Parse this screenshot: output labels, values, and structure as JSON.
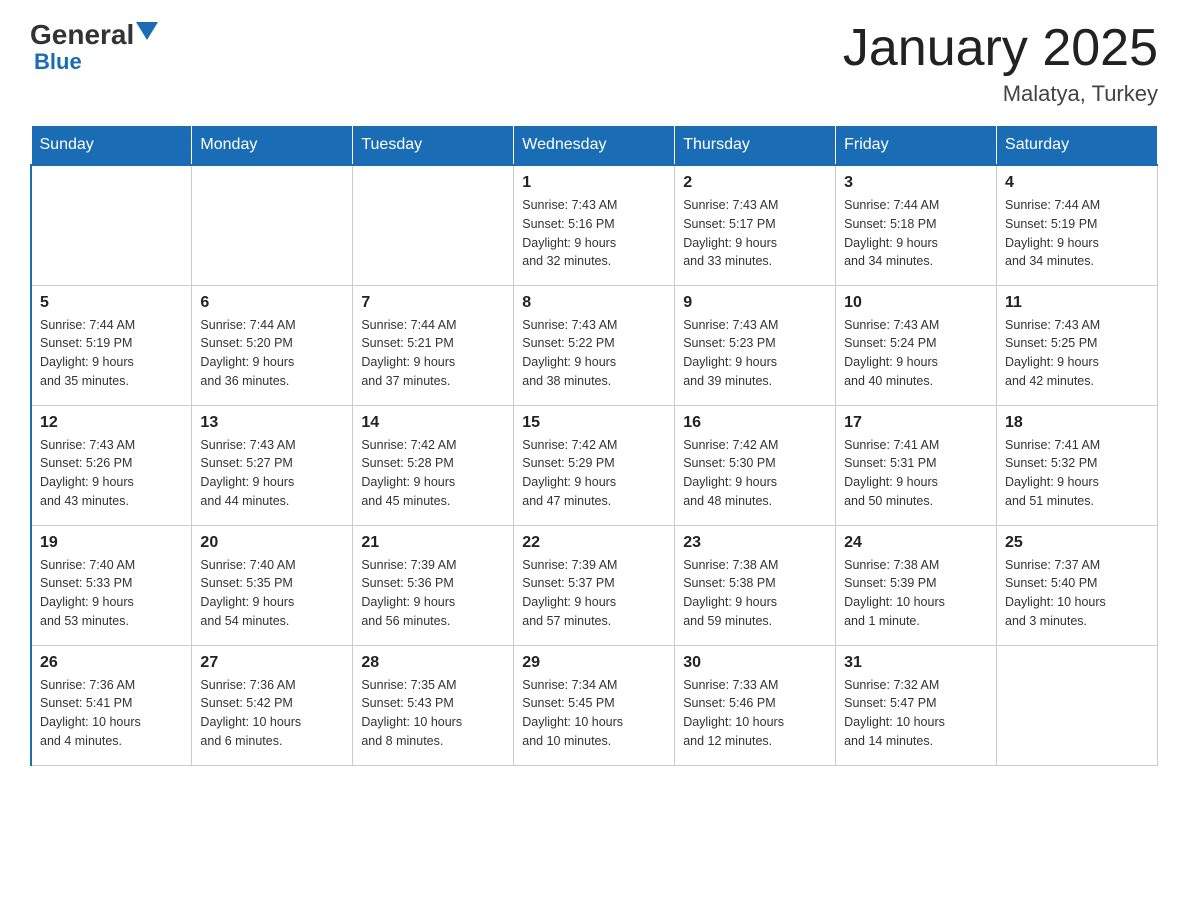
{
  "logo": {
    "general": "General",
    "blue": "Blue",
    "triangle": "▼"
  },
  "title": "January 2025",
  "subtitle": "Malatya, Turkey",
  "days_of_week": [
    "Sunday",
    "Monday",
    "Tuesday",
    "Wednesday",
    "Thursday",
    "Friday",
    "Saturday"
  ],
  "weeks": [
    [
      {
        "day": "",
        "info": ""
      },
      {
        "day": "",
        "info": ""
      },
      {
        "day": "",
        "info": ""
      },
      {
        "day": "1",
        "info": "Sunrise: 7:43 AM\nSunset: 5:16 PM\nDaylight: 9 hours\nand 32 minutes."
      },
      {
        "day": "2",
        "info": "Sunrise: 7:43 AM\nSunset: 5:17 PM\nDaylight: 9 hours\nand 33 minutes."
      },
      {
        "day": "3",
        "info": "Sunrise: 7:44 AM\nSunset: 5:18 PM\nDaylight: 9 hours\nand 34 minutes."
      },
      {
        "day": "4",
        "info": "Sunrise: 7:44 AM\nSunset: 5:19 PM\nDaylight: 9 hours\nand 34 minutes."
      }
    ],
    [
      {
        "day": "5",
        "info": "Sunrise: 7:44 AM\nSunset: 5:19 PM\nDaylight: 9 hours\nand 35 minutes."
      },
      {
        "day": "6",
        "info": "Sunrise: 7:44 AM\nSunset: 5:20 PM\nDaylight: 9 hours\nand 36 minutes."
      },
      {
        "day": "7",
        "info": "Sunrise: 7:44 AM\nSunset: 5:21 PM\nDaylight: 9 hours\nand 37 minutes."
      },
      {
        "day": "8",
        "info": "Sunrise: 7:43 AM\nSunset: 5:22 PM\nDaylight: 9 hours\nand 38 minutes."
      },
      {
        "day": "9",
        "info": "Sunrise: 7:43 AM\nSunset: 5:23 PM\nDaylight: 9 hours\nand 39 minutes."
      },
      {
        "day": "10",
        "info": "Sunrise: 7:43 AM\nSunset: 5:24 PM\nDaylight: 9 hours\nand 40 minutes."
      },
      {
        "day": "11",
        "info": "Sunrise: 7:43 AM\nSunset: 5:25 PM\nDaylight: 9 hours\nand 42 minutes."
      }
    ],
    [
      {
        "day": "12",
        "info": "Sunrise: 7:43 AM\nSunset: 5:26 PM\nDaylight: 9 hours\nand 43 minutes."
      },
      {
        "day": "13",
        "info": "Sunrise: 7:43 AM\nSunset: 5:27 PM\nDaylight: 9 hours\nand 44 minutes."
      },
      {
        "day": "14",
        "info": "Sunrise: 7:42 AM\nSunset: 5:28 PM\nDaylight: 9 hours\nand 45 minutes."
      },
      {
        "day": "15",
        "info": "Sunrise: 7:42 AM\nSunset: 5:29 PM\nDaylight: 9 hours\nand 47 minutes."
      },
      {
        "day": "16",
        "info": "Sunrise: 7:42 AM\nSunset: 5:30 PM\nDaylight: 9 hours\nand 48 minutes."
      },
      {
        "day": "17",
        "info": "Sunrise: 7:41 AM\nSunset: 5:31 PM\nDaylight: 9 hours\nand 50 minutes."
      },
      {
        "day": "18",
        "info": "Sunrise: 7:41 AM\nSunset: 5:32 PM\nDaylight: 9 hours\nand 51 minutes."
      }
    ],
    [
      {
        "day": "19",
        "info": "Sunrise: 7:40 AM\nSunset: 5:33 PM\nDaylight: 9 hours\nand 53 minutes."
      },
      {
        "day": "20",
        "info": "Sunrise: 7:40 AM\nSunset: 5:35 PM\nDaylight: 9 hours\nand 54 minutes."
      },
      {
        "day": "21",
        "info": "Sunrise: 7:39 AM\nSunset: 5:36 PM\nDaylight: 9 hours\nand 56 minutes."
      },
      {
        "day": "22",
        "info": "Sunrise: 7:39 AM\nSunset: 5:37 PM\nDaylight: 9 hours\nand 57 minutes."
      },
      {
        "day": "23",
        "info": "Sunrise: 7:38 AM\nSunset: 5:38 PM\nDaylight: 9 hours\nand 59 minutes."
      },
      {
        "day": "24",
        "info": "Sunrise: 7:38 AM\nSunset: 5:39 PM\nDaylight: 10 hours\nand 1 minute."
      },
      {
        "day": "25",
        "info": "Sunrise: 7:37 AM\nSunset: 5:40 PM\nDaylight: 10 hours\nand 3 minutes."
      }
    ],
    [
      {
        "day": "26",
        "info": "Sunrise: 7:36 AM\nSunset: 5:41 PM\nDaylight: 10 hours\nand 4 minutes."
      },
      {
        "day": "27",
        "info": "Sunrise: 7:36 AM\nSunset: 5:42 PM\nDaylight: 10 hours\nand 6 minutes."
      },
      {
        "day": "28",
        "info": "Sunrise: 7:35 AM\nSunset: 5:43 PM\nDaylight: 10 hours\nand 8 minutes."
      },
      {
        "day": "29",
        "info": "Sunrise: 7:34 AM\nSunset: 5:45 PM\nDaylight: 10 hours\nand 10 minutes."
      },
      {
        "day": "30",
        "info": "Sunrise: 7:33 AM\nSunset: 5:46 PM\nDaylight: 10 hours\nand 12 minutes."
      },
      {
        "day": "31",
        "info": "Sunrise: 7:32 AM\nSunset: 5:47 PM\nDaylight: 10 hours\nand 14 minutes."
      },
      {
        "day": "",
        "info": ""
      }
    ]
  ]
}
